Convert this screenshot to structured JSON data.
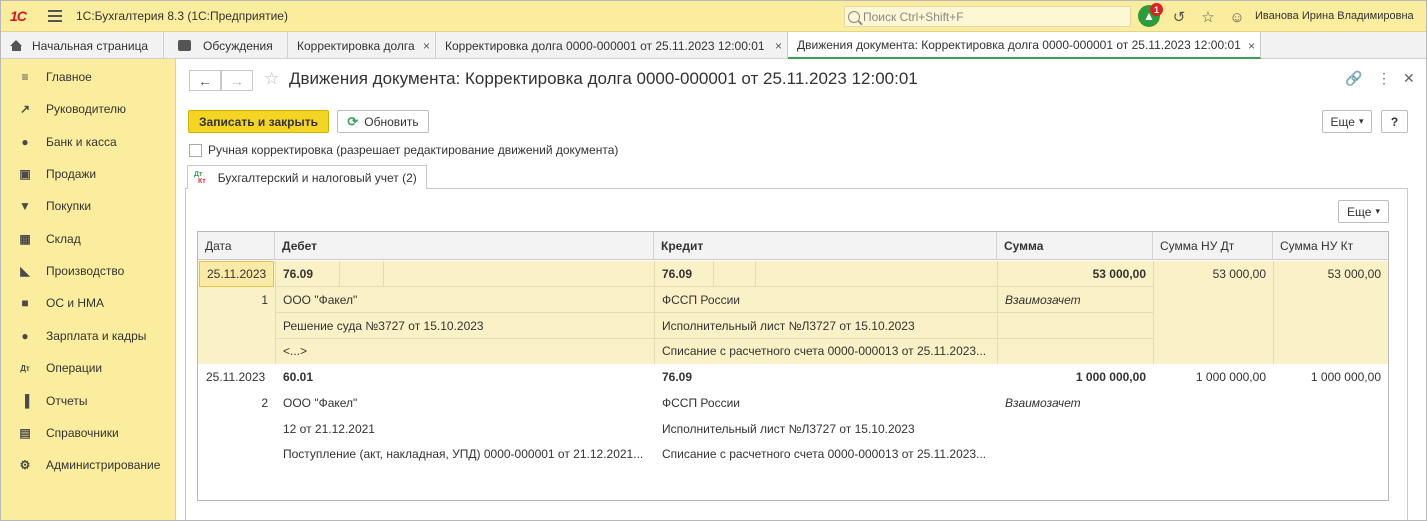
{
  "app": {
    "logo": "1С",
    "title": "1С:Бухгалтерия 8.3  (1С:Предприятие)",
    "search_placeholder": "Поиск Ctrl+Shift+F",
    "notifications_count": "1",
    "user": "Иванова Ирина Владимировна"
  },
  "tabs": [
    {
      "label": "Начальная страница",
      "icon": "home-icon"
    },
    {
      "label": "Обсуждения",
      "icon": "chat-icon"
    },
    {
      "label": "Корректировка долга",
      "close": "×"
    },
    {
      "label": "Корректировка долга 0000-000001 от 25.11.2023 12:00:01",
      "close": "×"
    },
    {
      "label": "Движения документа: Корректировка долга 0000-000001 от 25.11.2023 12:00:01",
      "close": "×",
      "active": true
    }
  ],
  "sidebar": {
    "items": [
      {
        "label": "Главное",
        "icon": "menu-lines-icon"
      },
      {
        "label": "Руководителю",
        "icon": "trend-icon"
      },
      {
        "label": "Банк и касса",
        "icon": "coin-icon"
      },
      {
        "label": "Продажи",
        "icon": "bag-icon"
      },
      {
        "label": "Покупки",
        "icon": "cart-icon"
      },
      {
        "label": "Склад",
        "icon": "warehouse-icon"
      },
      {
        "label": "Производство",
        "icon": "factory-icon"
      },
      {
        "label": "ОС и НМА",
        "icon": "truck-icon"
      },
      {
        "label": "Зарплата и кадры",
        "icon": "person-icon"
      },
      {
        "label": "Операции",
        "icon": "dt-kt-icon"
      },
      {
        "label": "Отчеты",
        "icon": "bar-chart-icon"
      },
      {
        "label": "Справочники",
        "icon": "books-icon"
      },
      {
        "label": "Администрирование",
        "icon": "gear-icon"
      }
    ]
  },
  "doc": {
    "title": "Движения документа: Корректировка долга 0000-000001 от 25.11.2023 12:00:01",
    "save_close": "Записать и закрыть",
    "refresh": "Обновить",
    "more": "Еще",
    "help": "?",
    "manual_correction": "Ручная корректировка (разрешает редактирование движений документа)",
    "subtab": "Бухгалтерский и налоговый учет (2)",
    "subtab_icon_dt": "Дт",
    "subtab_icon_kt": "Кт",
    "table_more": "Еще"
  },
  "table": {
    "columns": [
      "Дата",
      "Дебет",
      "Кредит",
      "Сумма",
      "Сумма НУ Дт",
      "Сумма НУ Кт"
    ],
    "rows": [
      {
        "date": "25.11.2023",
        "num": "1",
        "debit_account": "76.09",
        "debit_sub1": "ООО \"Факел\"",
        "debit_sub2": "Решение суда №3727 от 15.10.2023",
        "debit_sub3": "<...>",
        "credit_account": "76.09",
        "credit_sub1": "ФССП России",
        "credit_sub2": "Исполнительный лист №Л3727 от 15.10.2023",
        "credit_sub3": "Списание с расчетного счета 0000-000013 от 25.11.2023...",
        "sum": "53 000,00",
        "content": "Взаимозачет",
        "sum_nu_dt": "53 000,00",
        "sum_nu_kt": "53 000,00"
      },
      {
        "date": "25.11.2023",
        "num": "2",
        "debit_account": "60.01",
        "debit_sub1": "ООО \"Факел\"",
        "debit_sub2": "12 от 21.12.2021",
        "debit_sub3": "Поступление (акт, накладная, УПД) 0000-000001 от 21.12.2021...",
        "credit_account": "76.09",
        "credit_sub1": "ФССП России",
        "credit_sub2": "Исполнительный лист №Л3727 от 15.10.2023",
        "credit_sub3": "Списание с расчетного счета 0000-000013 от 25.11.2023...",
        "sum": "1 000 000,00",
        "content": "Взаимозачет",
        "sum_nu_dt": "1 000 000,00",
        "sum_nu_kt": "1 000 000,00"
      }
    ]
  }
}
